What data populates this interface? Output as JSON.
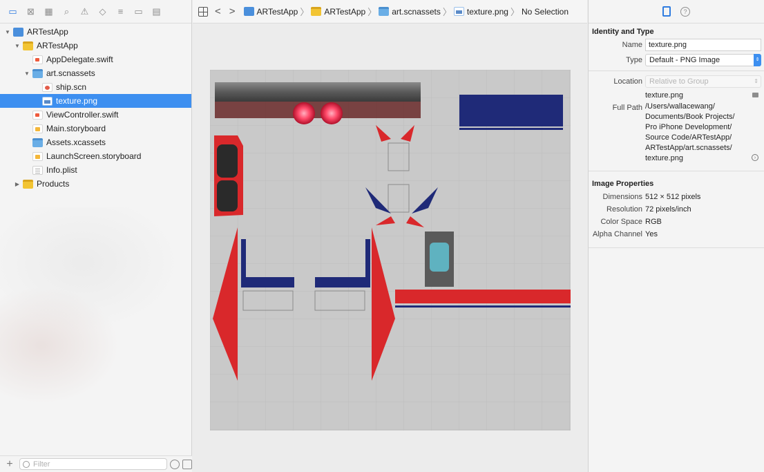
{
  "navigator": {
    "tabs": [
      {
        "icon": "folder-icon",
        "glyph": "▭",
        "active": true
      },
      {
        "icon": "source-control-icon",
        "glyph": "⊠"
      },
      {
        "icon": "symbol-icon",
        "glyph": "▦"
      },
      {
        "icon": "find-icon",
        "glyph": "⌕"
      },
      {
        "icon": "issue-icon",
        "glyph": "⚠"
      },
      {
        "icon": "test-icon",
        "glyph": "◇"
      },
      {
        "icon": "debug-icon",
        "glyph": "≡"
      },
      {
        "icon": "breakpoint-icon",
        "glyph": "▭"
      },
      {
        "icon": "report-icon",
        "glyph": "▤"
      }
    ],
    "tree": [
      {
        "label": "ARTestApp",
        "indent": 0,
        "disclosure": "open",
        "icon": "project"
      },
      {
        "label": "ARTestApp",
        "indent": 1,
        "disclosure": "open",
        "icon": "folder-yellow"
      },
      {
        "label": "AppDelegate.swift",
        "indent": 2,
        "icon": "swift"
      },
      {
        "label": "art.scnassets",
        "indent": 2,
        "disclosure": "open",
        "icon": "folder-blue"
      },
      {
        "label": "ship.scn",
        "indent": 3,
        "icon": "scn"
      },
      {
        "label": "texture.png",
        "indent": 3,
        "icon": "png",
        "selected": true
      },
      {
        "label": "ViewController.swift",
        "indent": 2,
        "icon": "swift"
      },
      {
        "label": "Main.storyboard",
        "indent": 2,
        "icon": "storyboard"
      },
      {
        "label": "Assets.xcassets",
        "indent": 2,
        "icon": "folder-blue"
      },
      {
        "label": "LaunchScreen.storyboard",
        "indent": 2,
        "icon": "storyboard"
      },
      {
        "label": "Info.plist",
        "indent": 2,
        "icon": "plist"
      },
      {
        "label": "Products",
        "indent": 1,
        "disclosure": "closed",
        "icon": "folder-yellow"
      }
    ],
    "filter_placeholder": "Filter",
    "add_label": "+"
  },
  "jump_bar": {
    "back": "<",
    "forward": ">",
    "crumbs": [
      {
        "label": "ARTestApp",
        "icon": "project"
      },
      {
        "label": "ARTestApp",
        "icon": "folder-yellow"
      },
      {
        "label": "art.scnassets",
        "icon": "folder-blue"
      },
      {
        "label": "texture.png",
        "icon": "png"
      },
      {
        "label": "No Selection",
        "icon": ""
      }
    ]
  },
  "inspector": {
    "identity": {
      "title": "Identity and Type",
      "name_label": "Name",
      "name_value": "texture.png",
      "type_label": "Type",
      "type_value": "Default - PNG Image",
      "location_label": "Location",
      "location_value": "Relative to Group",
      "filename": "texture.png",
      "full_path_label": "Full Path",
      "full_path_lines": [
        "/Users/wallacewang/",
        "Documents/Book Projects/",
        "Pro iPhone Development/",
        "Source Code/ARTestApp/",
        "ARTestApp/art.scnassets/",
        "texture.png"
      ]
    },
    "image_properties": {
      "title": "Image Properties",
      "rows": [
        {
          "label": "Dimensions",
          "value": "512 × 512 pixels"
        },
        {
          "label": "Resolution",
          "value": "72 pixels/inch"
        },
        {
          "label": "Color Space",
          "value": "RGB"
        },
        {
          "label": "Alpha Channel",
          "value": "Yes"
        }
      ]
    }
  },
  "colors": {
    "accent": "#3d8ff0",
    "texture_red": "#d9282b",
    "texture_blue": "#1f2a78",
    "texture_bg": "#c9c9c9"
  }
}
